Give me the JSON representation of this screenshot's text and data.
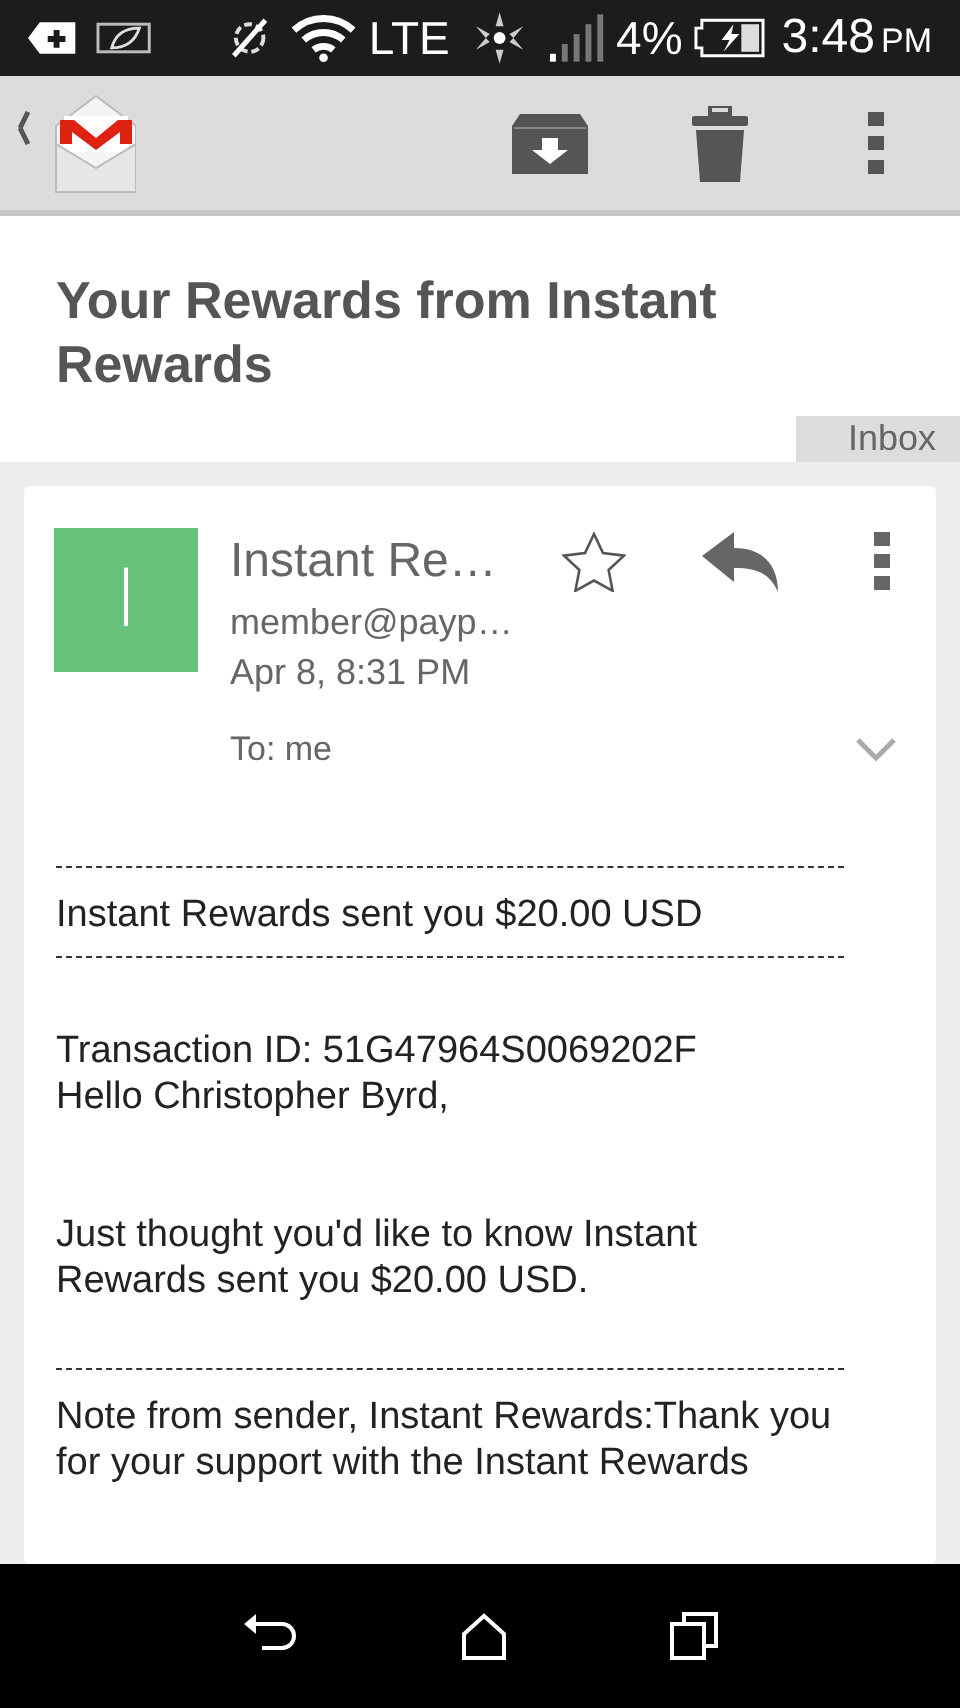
{
  "status_bar": {
    "battery": "4%",
    "network": "LTE",
    "time": "3:48",
    "time_suffix": "PM"
  },
  "subject": "Your Rewards from Instant Rewards",
  "label": "Inbox",
  "message": {
    "avatar_letter": "I",
    "sender": "Instant Re…",
    "email": "member@payp…",
    "date": "Apr 8, 8:31 PM",
    "to": "To: me",
    "starred": false
  },
  "body": [
    {
      "kind": "rule"
    },
    {
      "kind": "text",
      "text": "Instant Rewards sent you $20.00 USD"
    },
    {
      "kind": "rule"
    },
    {
      "kind": "gap"
    },
    {
      "kind": "text",
      "text": "Transaction ID: 51G47964S0069202F"
    },
    {
      "kind": "text",
      "text": "Hello Christopher Byrd,"
    },
    {
      "kind": "gap"
    },
    {
      "kind": "gap"
    },
    {
      "kind": "text",
      "text": "Just thought you'd like to know Instant Rewards sent you $20.00 USD."
    },
    {
      "kind": "gap"
    },
    {
      "kind": "rule"
    },
    {
      "kind": "text",
      "text": "Note from sender, Instant Rewards:Thank you for your support with the Instant Rewards"
    }
  ]
}
